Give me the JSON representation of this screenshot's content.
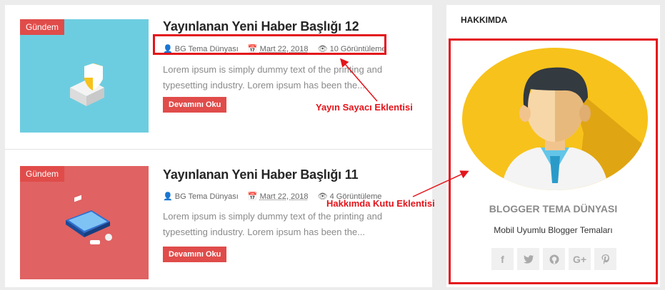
{
  "posts": [
    {
      "label": "Gündem",
      "title": "Yayınlanan Yeni Haber Başlığı 12",
      "author": "BG Tema Dünyası",
      "date": "Mart 22, 2018",
      "views": "10 Görüntüleme",
      "excerpt": "Lorem ipsum is simply dummy text of the printing and typesetting industry. Lorem ipsum has been the...",
      "more": "Devamını Oku"
    },
    {
      "label": "Gündem",
      "title": "Yayınlanan Yeni Haber Başlığı 11",
      "author": "BG Tema Dünyası",
      "date": "Mart 22, 2018",
      "views": "4 Görüntüleme",
      "excerpt": "Lorem ipsum is simply dummy text of the printing and typesetting industry. Lorem ipsum has been the...",
      "more": "Devamını Oku"
    }
  ],
  "sidebar": {
    "title": "HAKKIMDA",
    "name": "BLOGGER TEMA DÜNYASI",
    "description": "Mobil Uyumlu Blogger Temaları",
    "socials": [
      "facebook-icon",
      "twitter-icon",
      "github-icon",
      "google-plus-icon",
      "pinterest-icon"
    ]
  },
  "annotations": {
    "counter": "Yayın Sayacı Eklentisi",
    "about": "Hakkımda Kutu Eklentisi"
  },
  "colors": {
    "accent": "#e04c4a",
    "annotation": "#e3141b",
    "thumb1": "#6dcde0",
    "thumb2": "#e06262",
    "avatar_bg": "#f7c21b"
  }
}
